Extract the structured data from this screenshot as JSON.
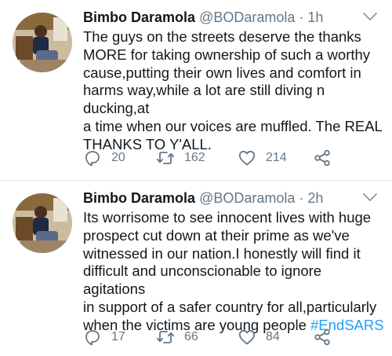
{
  "tweets": [
    {
      "name": "Bimbo Daramola",
      "handle": "@BODaramola",
      "separator": "·",
      "time": "1h",
      "text": "The guys on the streets deserve the thanks\nMORE for taking ownership of such a worthy\ncause,putting their own lives and comfort in\nharms way,while a lot are still diving n ducking,at\na time when our voices are muffled. The REAL\nTHANKS TO Y'ALL.",
      "hashtag": "",
      "replies": "20",
      "retweets": "162",
      "likes": "214"
    },
    {
      "name": "Bimbo Daramola",
      "handle": "@BODaramola",
      "separator": "·",
      "time": "2h",
      "text": "Its worrisome to see innocent lives with huge\nprospect cut down at their prime as we've\nwitnessed in our nation.I honestly will find it\ndifficult and unconscionable to ignore agitations\nin support of a safer country for all,particularly\nwhen the victims are young people ",
      "hashtag": "#EndSARS",
      "replies": "17",
      "retweets": "66",
      "likes": "84"
    }
  ],
  "icons": {
    "reply": "reply-icon",
    "retweet": "retweet-icon",
    "like": "heart-icon",
    "share": "share-icon",
    "more": "chevron-down-icon"
  },
  "colors": {
    "text": "#14171a",
    "muted": "#657786",
    "link": "#1da1f2",
    "divider": "#e1e8ed"
  }
}
